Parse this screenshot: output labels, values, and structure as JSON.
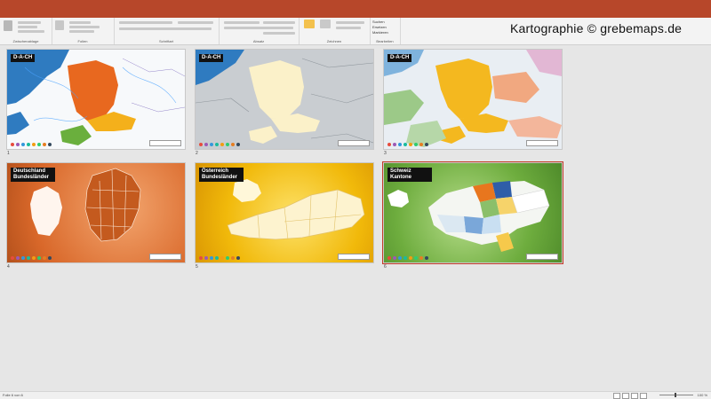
{
  "window": {
    "title_bar_color": "#b7472a"
  },
  "watermark": {
    "text": "Kartographie © grebemaps.de"
  },
  "ribbon": {
    "groups": [
      {
        "label": "Zwischenablage"
      },
      {
        "label": "Folien"
      },
      {
        "label": "Schriftart"
      },
      {
        "label": "Absatz"
      },
      {
        "label": "Zeichnen"
      },
      {
        "label": "Bearbeiten"
      }
    ],
    "buttons": {
      "paste": "Einfügen",
      "new_slide": "Neue Folie",
      "arrange": "Anordnen",
      "search": "Suchen",
      "replace": "Ersetzen",
      "select": "Markieren"
    }
  },
  "slides": [
    {
      "number": "1",
      "title": "D-A-CH",
      "theme": "blue-orange"
    },
    {
      "number": "2",
      "title": "D-A-CH",
      "theme": "grey-cream"
    },
    {
      "number": "3",
      "title": "D-A-CH",
      "theme": "light-yellow"
    },
    {
      "number": "4",
      "title_line1": "Deutschland",
      "title_line2": "Bundesländer",
      "theme": "orange"
    },
    {
      "number": "5",
      "title_line1": "Österreich",
      "title_line2": "Bundesländer",
      "theme": "yellow"
    },
    {
      "number": "6",
      "title_line1": "Schweiz",
      "title_line2": "Kantone",
      "theme": "green",
      "selected": true
    }
  ],
  "status": {
    "slide_info": "Folie 6 von 6",
    "zoom": "100 %"
  },
  "colors": {
    "accent": "#b7472a",
    "selection": "#c53d2a"
  }
}
